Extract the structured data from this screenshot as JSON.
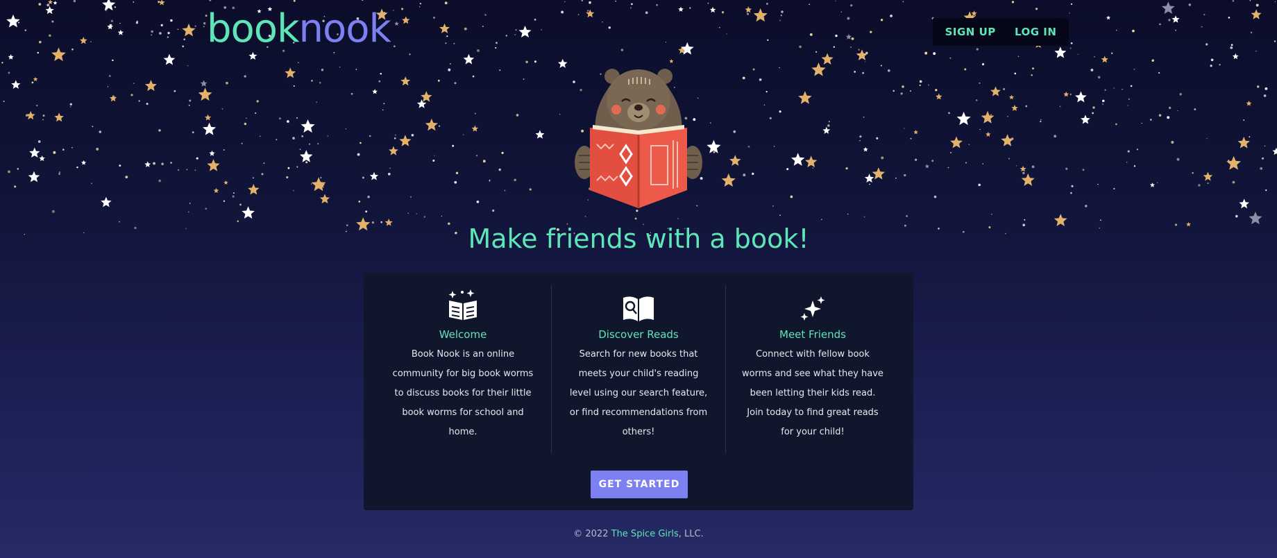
{
  "header": {
    "logo_part1": "book",
    "logo_part2": "nook",
    "signup_label": "SIGN UP",
    "login_label": "LOG IN"
  },
  "hero": {
    "tagline": "Make friends with a book!"
  },
  "features": [
    {
      "icon": "open-book-sparkles-icon",
      "title": "Welcome",
      "text": "Book Nook is an online community for big book worms to discuss books for their little book worms for school and home."
    },
    {
      "icon": "book-search-icon",
      "title": "Discover Reads",
      "text": "Search for new books that meets your child's reading level using our search feature, or find recommendations from others!"
    },
    {
      "icon": "sparkles-icon",
      "title": "Meet Friends",
      "text": "Connect with fellow book worms and see what they have been letting their kids read. Join today to find great reads for your child!"
    }
  ],
  "cta": {
    "label": "GET STARTED"
  },
  "footer": {
    "prefix": "© 2022",
    "brand": "The Spice Girls",
    "suffix": ", LLC."
  },
  "colors": {
    "accent_green": "#5ee6b8",
    "accent_purple": "#7c80f0",
    "card_bg": "#10162c",
    "book_red": "#ee5a4a",
    "bear_brown": "#6f5e4c"
  }
}
